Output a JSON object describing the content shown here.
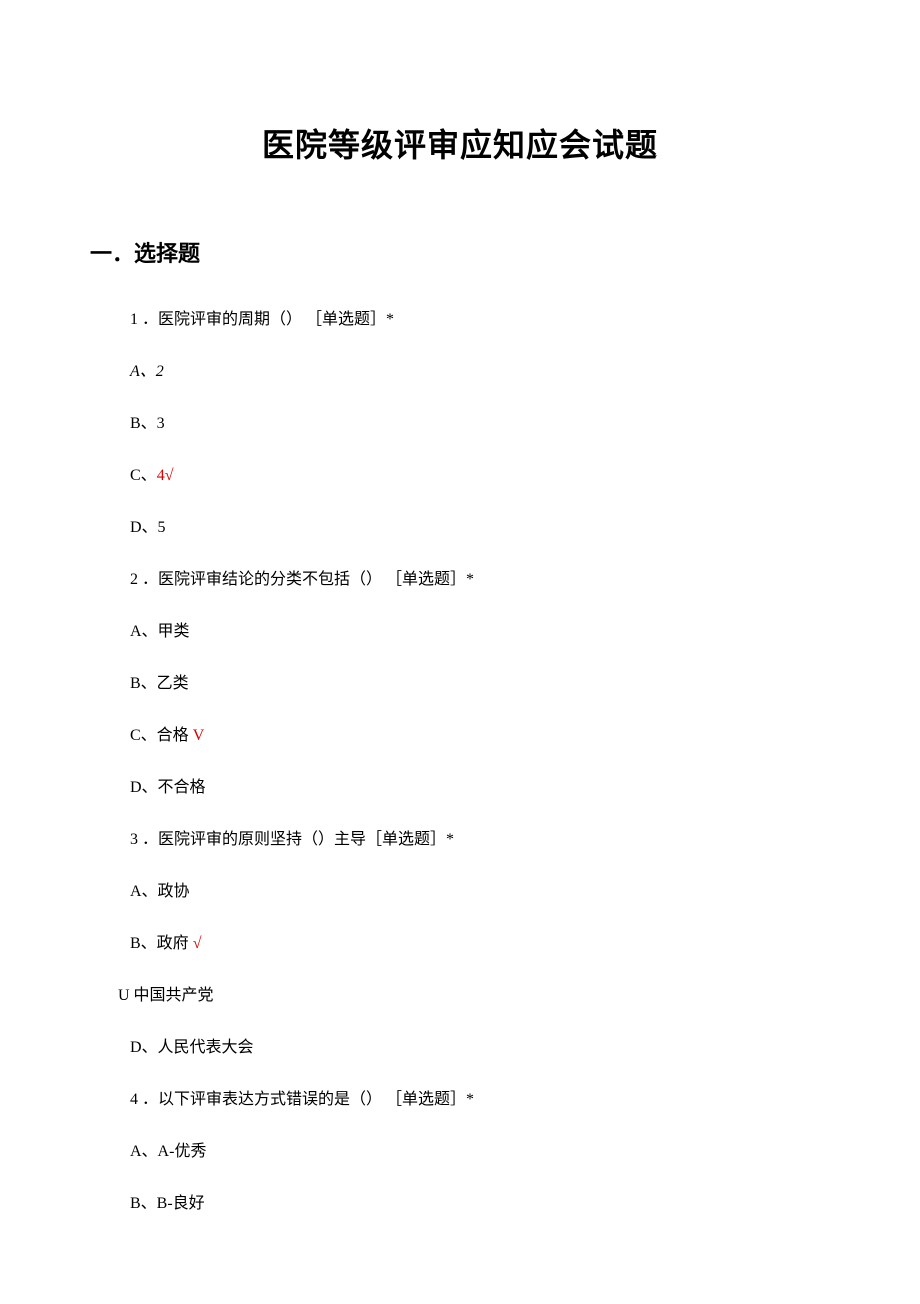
{
  "title": "医院等级评审应知应会试题",
  "section_header": "一．选择题",
  "q1": {
    "text": "1 ．医院评审的周期（） ［单选题］*",
    "optA_prefix": "A",
    "optA_sep": "、",
    "optA_val": "2",
    "optB": "B、3",
    "optC_prefix": "C、",
    "optC_val": "4√",
    "optD": "D、5"
  },
  "q2": {
    "text": "2 ．医院评审结论的分类不包括（） ［单选题］*",
    "optA": "A、甲类",
    "optB": "B、乙类",
    "optC_prefix": "C、合格 ",
    "optC_mark": "V",
    "optD": "D、不合格"
  },
  "q3": {
    "text": "3 ．医院评审的原则坚持（）主导［单选题］*",
    "optA": "A、政协",
    "optB_prefix": "B、政府 ",
    "optB_mark": "√",
    "optC": "U 中国共产党",
    "optD": "D、人民代表大会"
  },
  "q4": {
    "text": "4 ．以下评审表达方式错误的是（） ［单选题］*",
    "optA": "A、A-优秀",
    "optB": "B、B-良好"
  }
}
